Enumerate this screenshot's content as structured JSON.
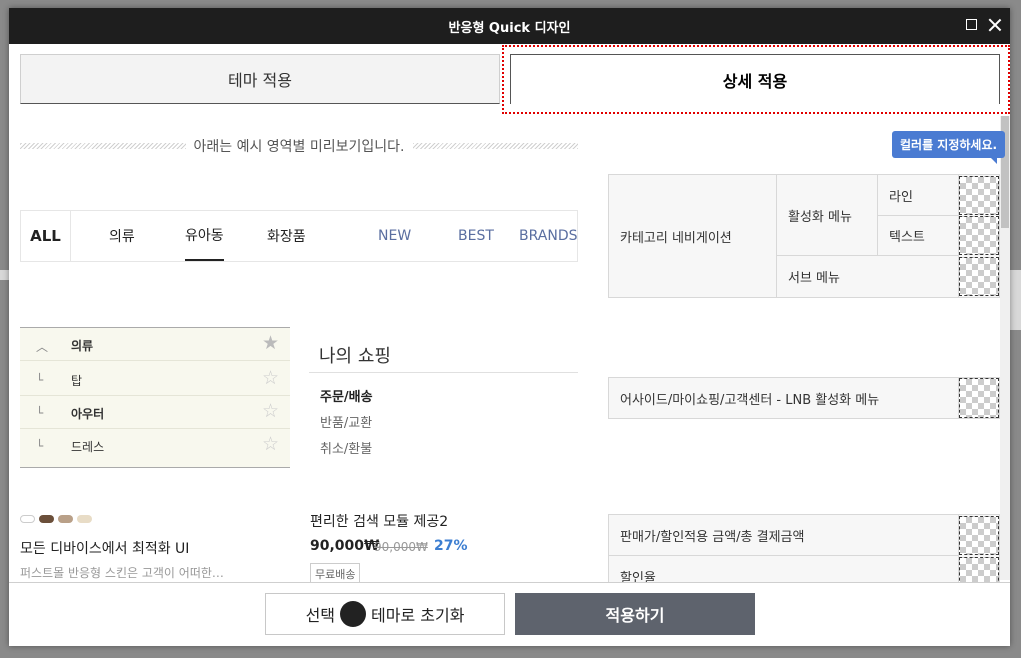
{
  "window": {
    "title": "반응형 Quick 디자인"
  },
  "tabs": {
    "theme": "테마 적용",
    "detail": "상세 적용"
  },
  "preview": {
    "notice": "아래는 예시 영역별 미리보기입니다."
  },
  "category_nav": {
    "all": "ALL",
    "items": [
      "의류",
      "유아동",
      "화장품",
      "NEW",
      "BEST",
      "BRANDS"
    ]
  },
  "lnb": {
    "rows": [
      {
        "mark": "︿",
        "label": "의류"
      },
      {
        "mark": "└",
        "label": "탑"
      },
      {
        "mark": "└",
        "label": "아우터"
      },
      {
        "mark": "└",
        "label": "드레스"
      }
    ],
    "star": "★",
    "star_outline": "☆"
  },
  "my_shopping": {
    "title": "나의 쇼핑",
    "items": [
      "주문/배송",
      "반품/교환",
      "취소/환불"
    ]
  },
  "product": {
    "swatch_colors": [
      "#ffffff",
      "#6b4f3a",
      "#b9a088",
      "#e8dcc6"
    ],
    "title": "모든 디바이스에서 최적화 UI",
    "desc": "퍼스트몰 반응형 스킨은 고객이 어떠한…"
  },
  "search_product": {
    "title": "편리한 검색 모듈 제공2",
    "price": "90,000₩",
    "original_price": "90,000₩",
    "discount": "27%",
    "badge": "무료배송"
  },
  "color_panel": {
    "tooltip": "컬러를 지정하세요.",
    "category_nav_label": "카테고리 네비게이션",
    "active_menu": "활성화 메뉴",
    "line": "라인",
    "text": "텍스트",
    "sub_menu": "서브 메뉴",
    "lnb_active": "어사이드/마이쇼핑/고객센터 - LNB 활성화 메뉴",
    "price_label": "판매가/할인적용 금액/총 결제금액",
    "discount_label": "할인율"
  },
  "footer": {
    "reset_prefix": "선택",
    "reset_suffix": "테마로 초기화",
    "apply": "적용하기"
  }
}
